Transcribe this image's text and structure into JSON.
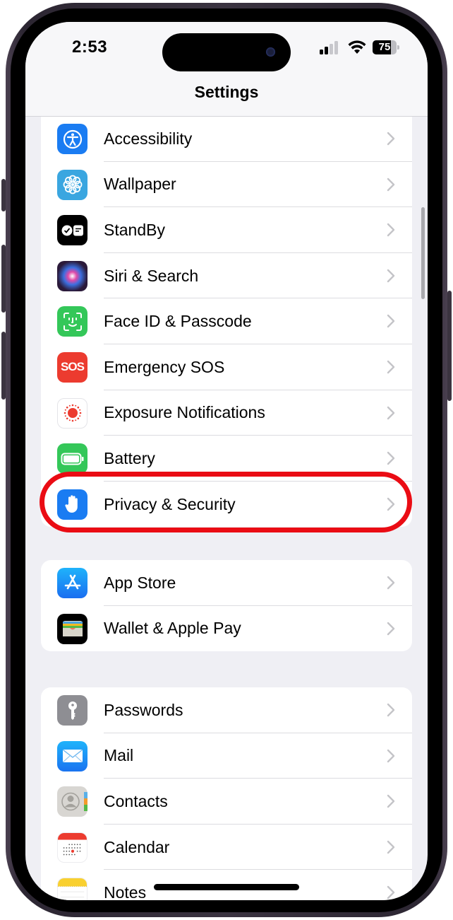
{
  "status_bar": {
    "time": "2:53",
    "signal_bars_active": 2,
    "signal_bars_total": 4,
    "wifi": "wifi-icon",
    "battery_percent": "75",
    "battery_level": 0.75
  },
  "nav": {
    "title": "Settings"
  },
  "colors": {
    "highlight": "#ea0c14",
    "group_background": "#efeff4",
    "chevron": "#c4c4c8"
  },
  "groups": [
    {
      "items": [
        {
          "label": "Accessibility",
          "icon": "accessibility-icon",
          "icon_color": "#1a7cf2"
        },
        {
          "label": "Wallpaper",
          "icon": "wallpaper-flower-icon",
          "icon_color": "#3aa6e0"
        },
        {
          "label": "StandBy",
          "icon": "standby-icon",
          "icon_color": "#000000"
        },
        {
          "label": "Siri & Search",
          "icon": "siri-icon",
          "icon_color": "#2b1a3a"
        },
        {
          "label": "Face ID & Passcode",
          "icon": "face-id-icon",
          "icon_color": "#34c759"
        },
        {
          "label": "Emergency SOS",
          "icon": "sos-icon",
          "icon_color": "#ec3b2f",
          "icon_text": "SOS"
        },
        {
          "label": "Exposure Notifications",
          "icon": "exposure-icon",
          "icon_color": "#ffffff"
        },
        {
          "label": "Battery",
          "icon": "battery-icon",
          "icon_color": "#34c759"
        },
        {
          "label": "Privacy & Security",
          "icon": "privacy-hand-icon",
          "icon_color": "#1a7cf2",
          "highlighted": true
        }
      ]
    },
    {
      "items": [
        {
          "label": "App Store",
          "icon": "app-store-icon",
          "icon_color": "#1a8cf5"
        },
        {
          "label": "Wallet & Apple Pay",
          "icon": "wallet-icon",
          "icon_color": "#000000"
        }
      ]
    },
    {
      "items": [
        {
          "label": "Passwords",
          "icon": "key-icon",
          "icon_color": "#8e8e93"
        },
        {
          "label": "Mail",
          "icon": "mail-icon",
          "icon_color": "#1e90f5"
        },
        {
          "label": "Contacts",
          "icon": "contacts-icon",
          "icon_color": "#d8d6d2"
        },
        {
          "label": "Calendar",
          "icon": "calendar-icon",
          "icon_color": "#ffffff"
        },
        {
          "label": "Notes",
          "icon": "notes-icon",
          "icon_color": "#ffffff"
        }
      ]
    }
  ]
}
